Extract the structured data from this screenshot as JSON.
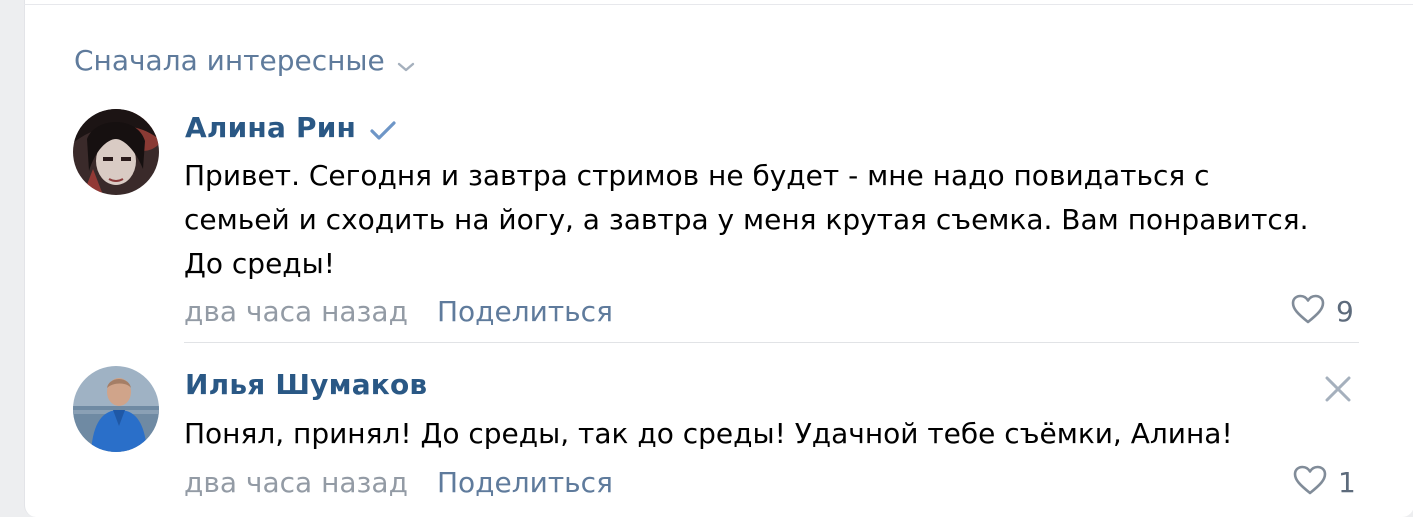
{
  "sort": {
    "label": "Сначала интересные"
  },
  "comments": [
    {
      "author": "Алина Рин",
      "verified": true,
      "text_lines": [
        "Привет. Сегодня и завтра стримов не будет - мне надо повидаться с",
        "семьей и сходить на йогу, а завтра у меня крутая съемка. Вам понравится.",
        "До среды!"
      ],
      "time": "два часа назад",
      "share_label": "Поделиться",
      "likes": "9"
    },
    {
      "author": "Илья Шумаков",
      "verified": false,
      "text_lines": [
        "Понял, принял! До среды, так до среды! Удачной тебе съёмки, Алина!"
      ],
      "time": "два часа назад",
      "share_label": "Поделиться",
      "likes": "1"
    }
  ],
  "icons": {
    "sort_chevron": "chevron-down-icon",
    "verified": "verified-check-icon",
    "like": "heart-icon",
    "close": "close-icon"
  },
  "colors": {
    "link": "#2a5885",
    "accent_muted": "#5f7b9c",
    "meta": "#939ba5",
    "verified": "#5181b8"
  }
}
